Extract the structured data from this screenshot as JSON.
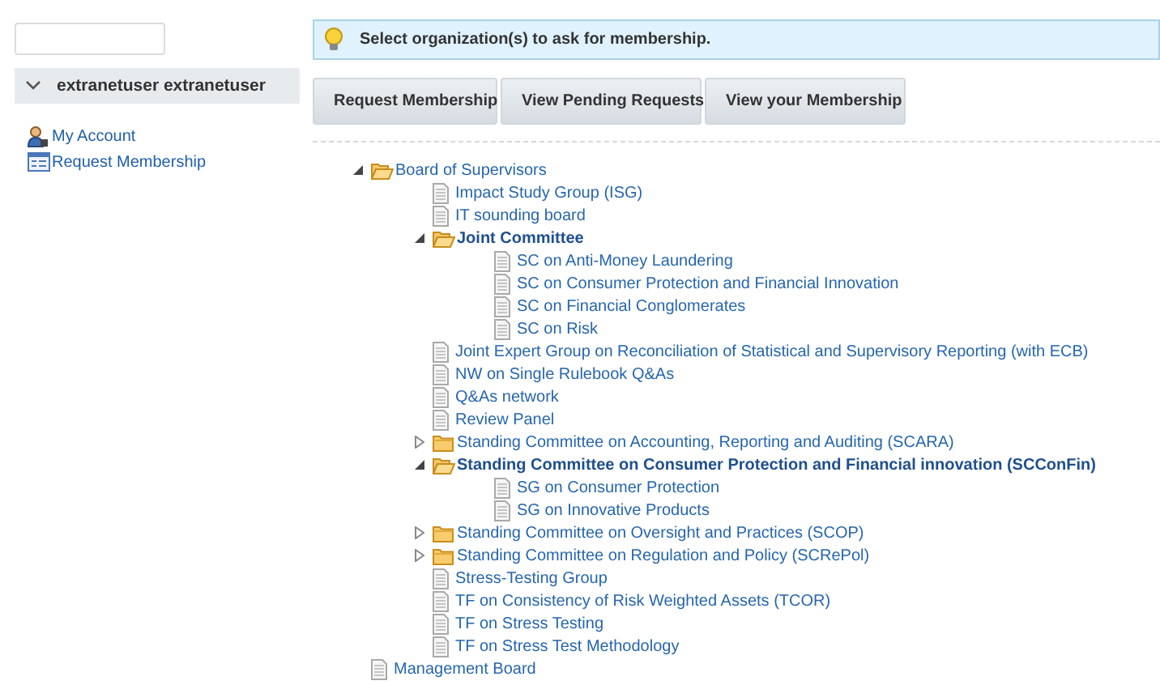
{
  "sidebar": {
    "user_panel": {
      "name": "extranetuser extranetuser",
      "expanded": true
    },
    "links": [
      {
        "label": "My Account",
        "kind": "account"
      },
      {
        "label": "Request Membership",
        "kind": "form"
      }
    ]
  },
  "info_bar": {
    "message": "Select organization(s) to ask for membership."
  },
  "buttons": [
    "Request Membership",
    "View Pending Requests",
    "View your Membership"
  ],
  "tree": [
    {
      "label": "Board of Supervisors",
      "kind": "folder",
      "expanded": true,
      "selected": false,
      "children": [
        {
          "label": "Impact Study Group (ISG)",
          "kind": "document",
          "selected": false
        },
        {
          "label": "IT sounding board",
          "kind": "document",
          "selected": false
        },
        {
          "label": "Joint Committee",
          "kind": "folder",
          "expanded": true,
          "selected": true,
          "children": [
            {
              "label": "SC on Anti-Money Laundering",
              "kind": "document",
              "selected": false
            },
            {
              "label": "SC on Consumer Protection and Financial Innovation",
              "kind": "document",
              "selected": false
            },
            {
              "label": "SC on Financial Conglomerates",
              "kind": "document",
              "selected": false
            },
            {
              "label": "SC on Risk",
              "kind": "document",
              "selected": false
            }
          ]
        },
        {
          "label": "Joint Expert Group on Reconciliation of Statistical and Supervisory Reporting (with ECB)",
          "kind": "document",
          "selected": false
        },
        {
          "label": "NW on Single Rulebook Q&As",
          "kind": "document",
          "selected": false
        },
        {
          "label": "Q&As network",
          "kind": "document",
          "selected": false
        },
        {
          "label": "Review Panel",
          "kind": "document",
          "selected": false
        },
        {
          "label": "Standing Committee on Accounting, Reporting and Auditing (SCARA)",
          "kind": "folder",
          "expanded": false,
          "selected": false
        },
        {
          "label": "Standing Committee on Consumer Protection and Financial innovation (SCConFin)",
          "kind": "folder",
          "expanded": true,
          "selected": true,
          "children": [
            {
              "label": "SG on Consumer Protection",
              "kind": "document",
              "selected": false
            },
            {
              "label": "SG on Innovative Products",
              "kind": "document",
              "selected": false
            }
          ]
        },
        {
          "label": "Standing Committee on Oversight and Practices (SCOP)",
          "kind": "folder",
          "expanded": false,
          "selected": false
        },
        {
          "label": "Standing Committee on Regulation and Policy (SCRePol)",
          "kind": "folder",
          "expanded": false,
          "selected": false
        },
        {
          "label": "Stress-Testing Group",
          "kind": "document",
          "selected": false
        },
        {
          "label": "TF on Consistency of Risk Weighted Assets (TCOR)",
          "kind": "document",
          "selected": false
        },
        {
          "label": "TF on Stress Testing",
          "kind": "document",
          "selected": false
        },
        {
          "label": "TF on Stress Test Methodology",
          "kind": "document",
          "selected": false
        }
      ]
    },
    {
      "label": "Management Board",
      "kind": "document",
      "selected": false
    }
  ]
}
